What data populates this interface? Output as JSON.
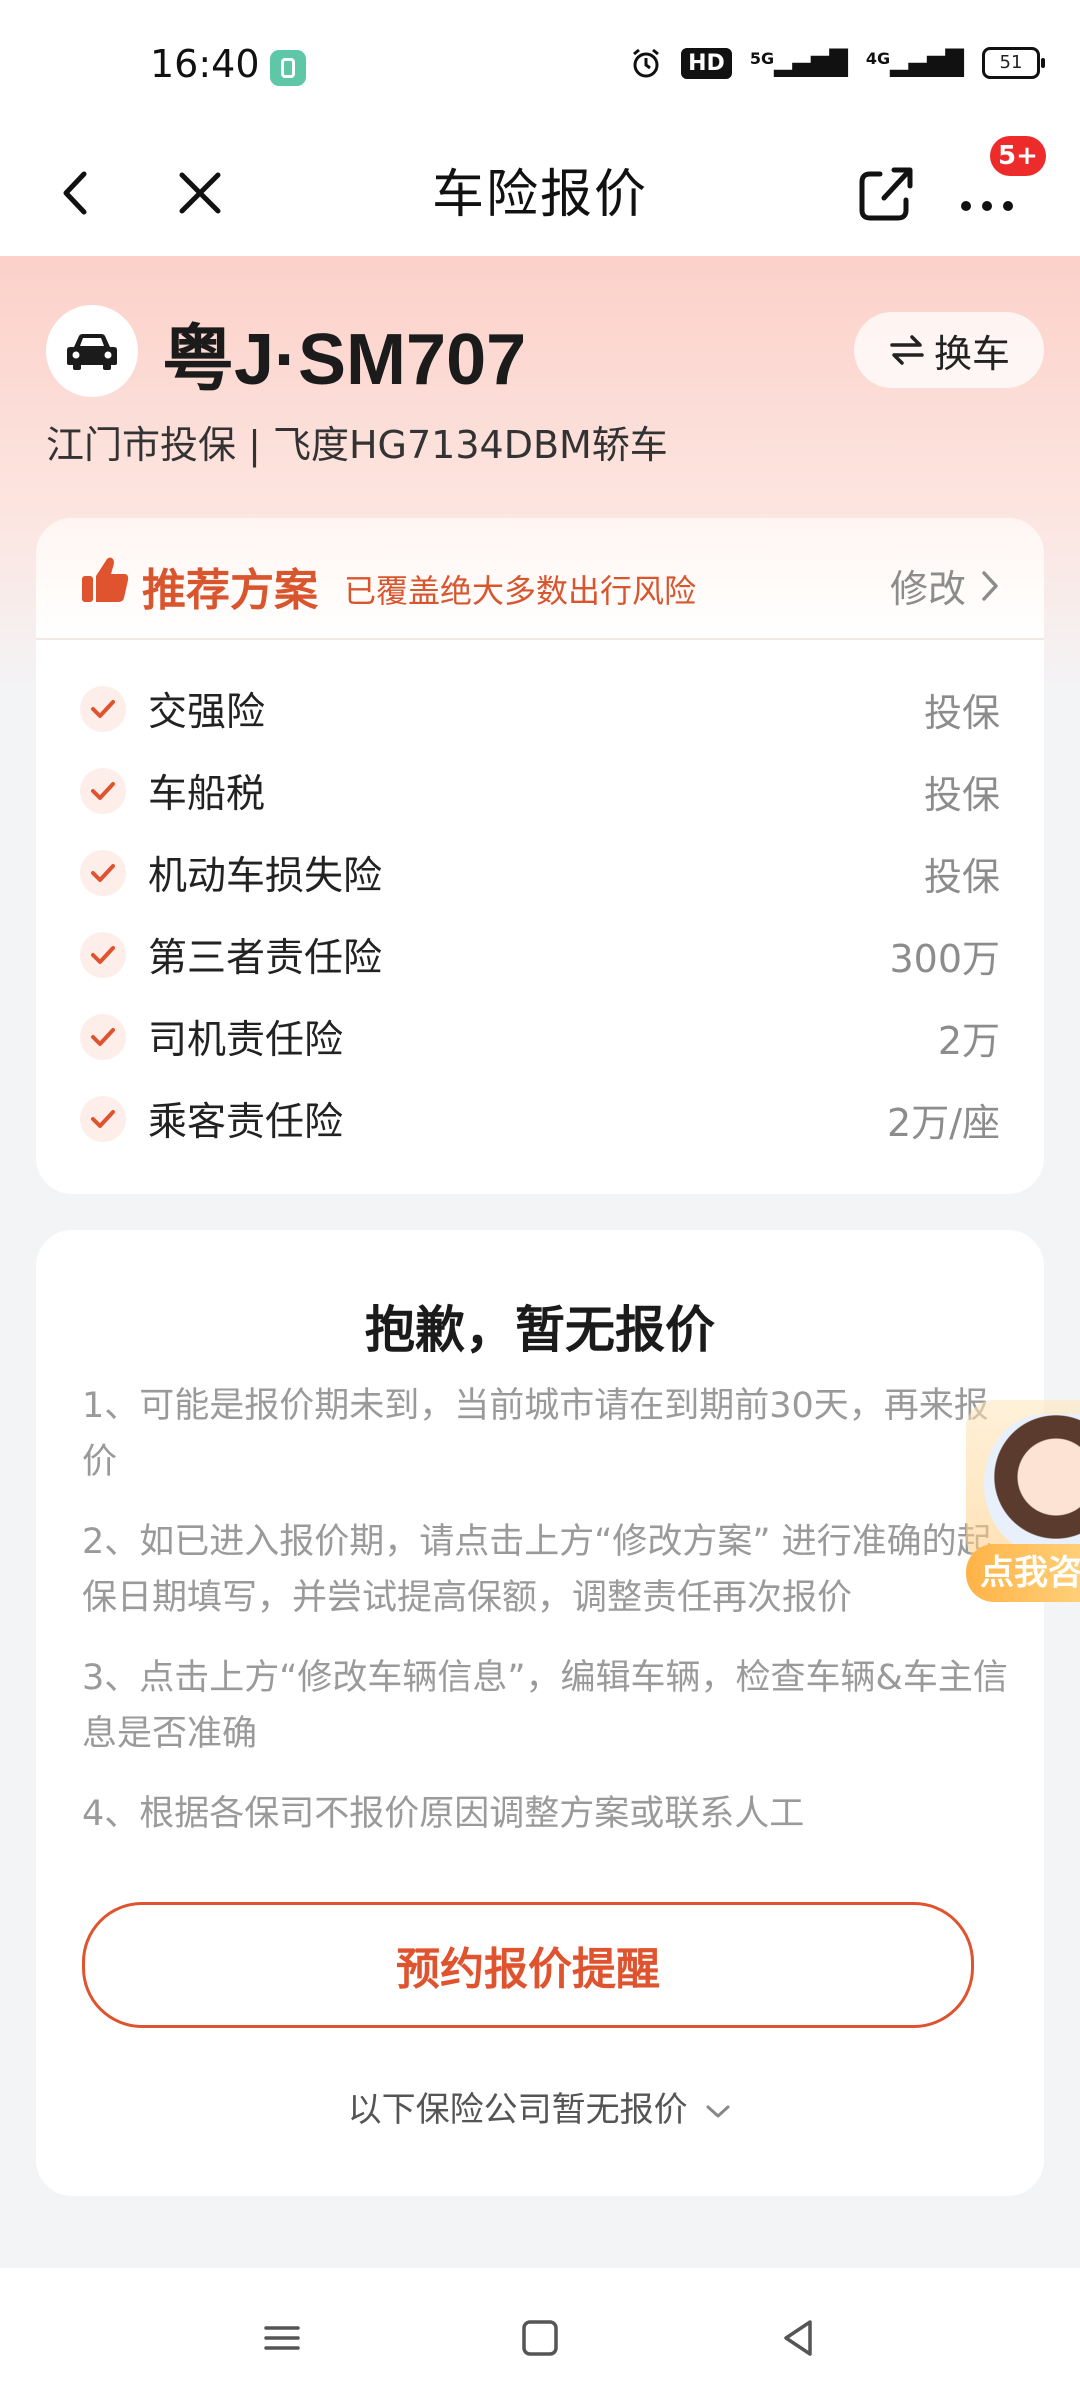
{
  "status_bar": {
    "time": "16:40",
    "hd_label": "HD",
    "signal1_label": "5G",
    "signal2_label": "4G",
    "battery": "51"
  },
  "nav": {
    "title": "车险报价",
    "more_badge": "5+"
  },
  "vehicle": {
    "plate": "粤J·SM707",
    "swap_label": "换车",
    "subtitle": "江门市投保 | 飞度HG7134DBM轿车"
  },
  "plan": {
    "title": "推荐方案",
    "description": "已覆盖绝大多数出行风险",
    "modify_label": "修改",
    "items": [
      {
        "name": "交强险",
        "value": "投保"
      },
      {
        "name": "车船税",
        "value": "投保"
      },
      {
        "name": "机动车损失险",
        "value": "投保"
      },
      {
        "name": "第三者责任险",
        "value": "300万"
      },
      {
        "name": "司机责任险",
        "value": "2万"
      },
      {
        "name": "乘客责任险",
        "value": "2万/座"
      }
    ]
  },
  "quote": {
    "title": "抱歉，暂无报价",
    "tips": [
      "1、可能是报价期未到，当前城市请在到期前30天，再来报价",
      "2、如已进入报价期，请点击上方“修改方案” 进行准确的起保日期填写，并尝试提高保额，调整责任再次报价",
      "3、点击上方“修改车辆信息”，编辑车辆，检查车辆&车主信息是否准确",
      "4、根据各保司不报价原因调整方案或联系人工"
    ],
    "remind_button": "预约报价提醒",
    "no_quote_toggle": "以下保险公司暂无报价"
  },
  "assistant": {
    "label": "点我咨"
  },
  "colors": {
    "accent": "#e0532f",
    "hero_top": "#fbd1c9",
    "badge": "#ee2b2b"
  }
}
